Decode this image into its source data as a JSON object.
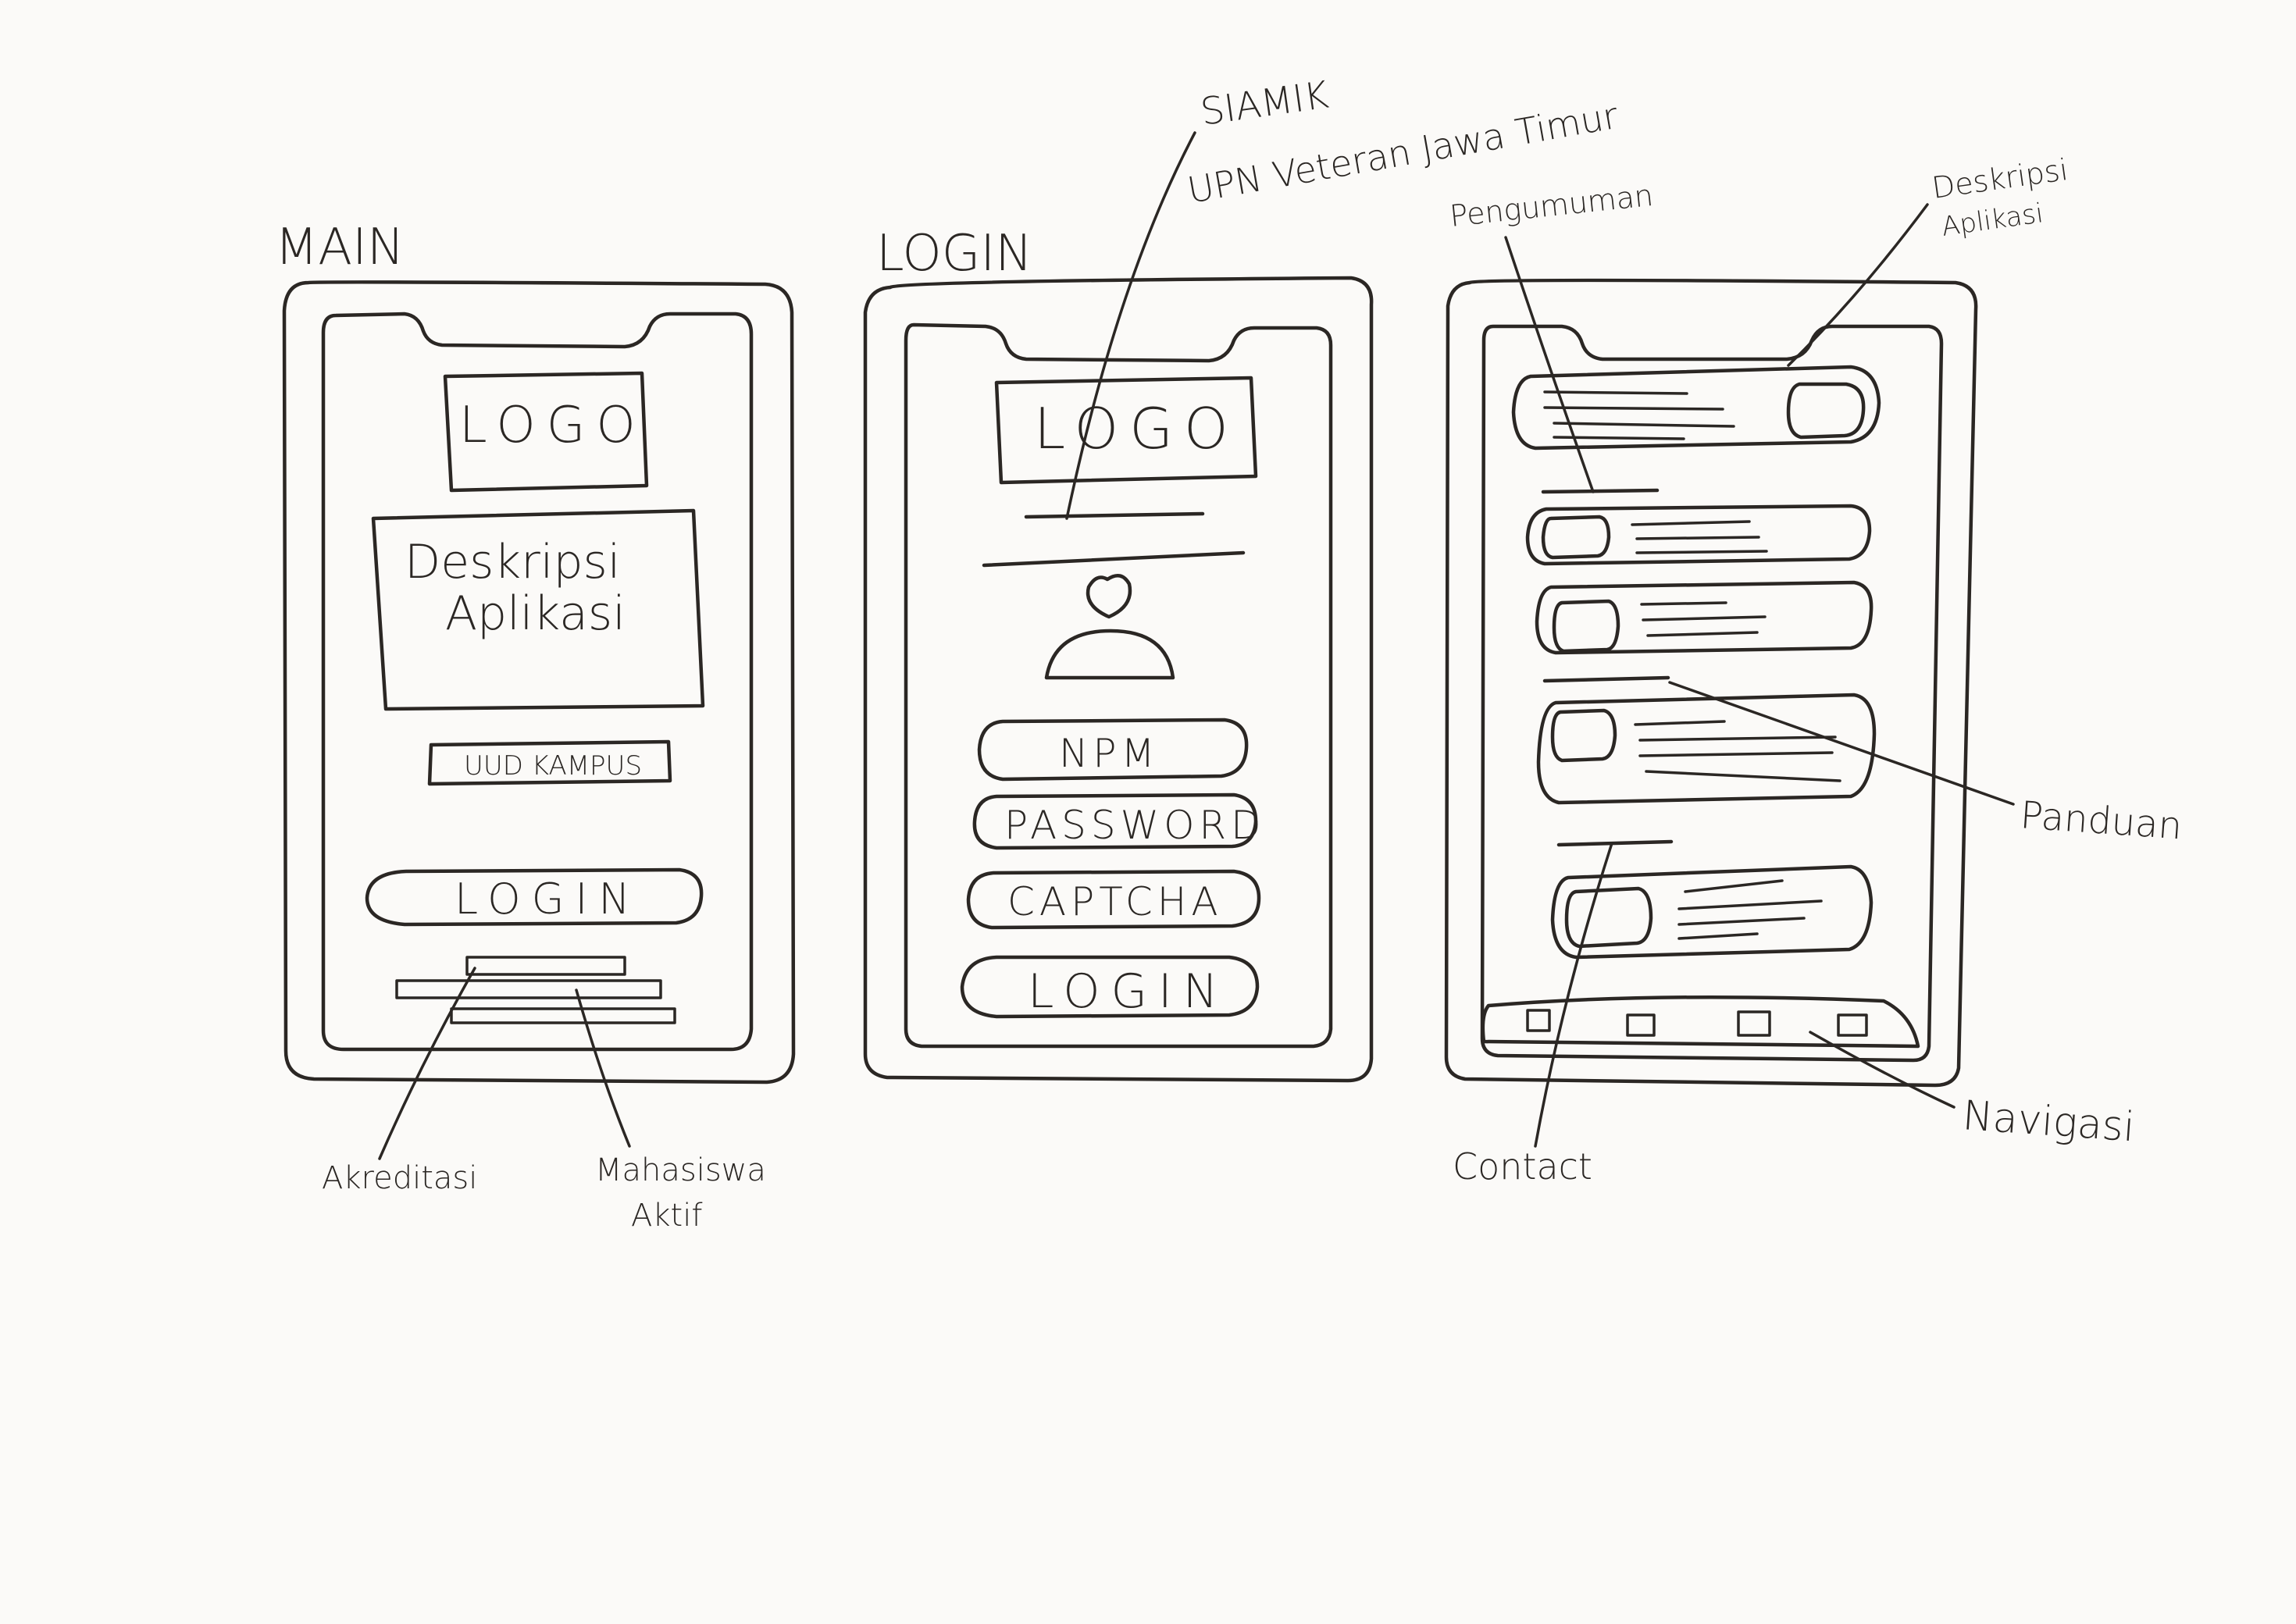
{
  "screens": {
    "main": {
      "title": "MAIN",
      "logo": "LOGO",
      "description_line1": "Deskripsi",
      "description_line2": "Aplikasi",
      "uud_button": "UUD KAMPUS",
      "login_button": "LOGIN"
    },
    "login": {
      "title": "LOGIN",
      "logo": "LOGO",
      "npm_field": "NPM",
      "password_field": "PASSWORD",
      "captcha_field": "CAPTCHA",
      "login_button": "LOGIN"
    }
  },
  "annotations": {
    "akreditasi": "Akreditasi",
    "mahasiswa_line1": "Mahasiswa",
    "mahasiswa_line2": "Aktif",
    "siamik_line1": "SIAMIK",
    "siamik_line2": "UPN Veteran Jawa Timur",
    "pengumuman": "Pengumuman",
    "deskripsi_line1": "Deskripsi",
    "deskripsi_line2": "Aplikasi",
    "panduan": "Panduan",
    "contact": "Contact",
    "navigasi": "Navigasi"
  }
}
